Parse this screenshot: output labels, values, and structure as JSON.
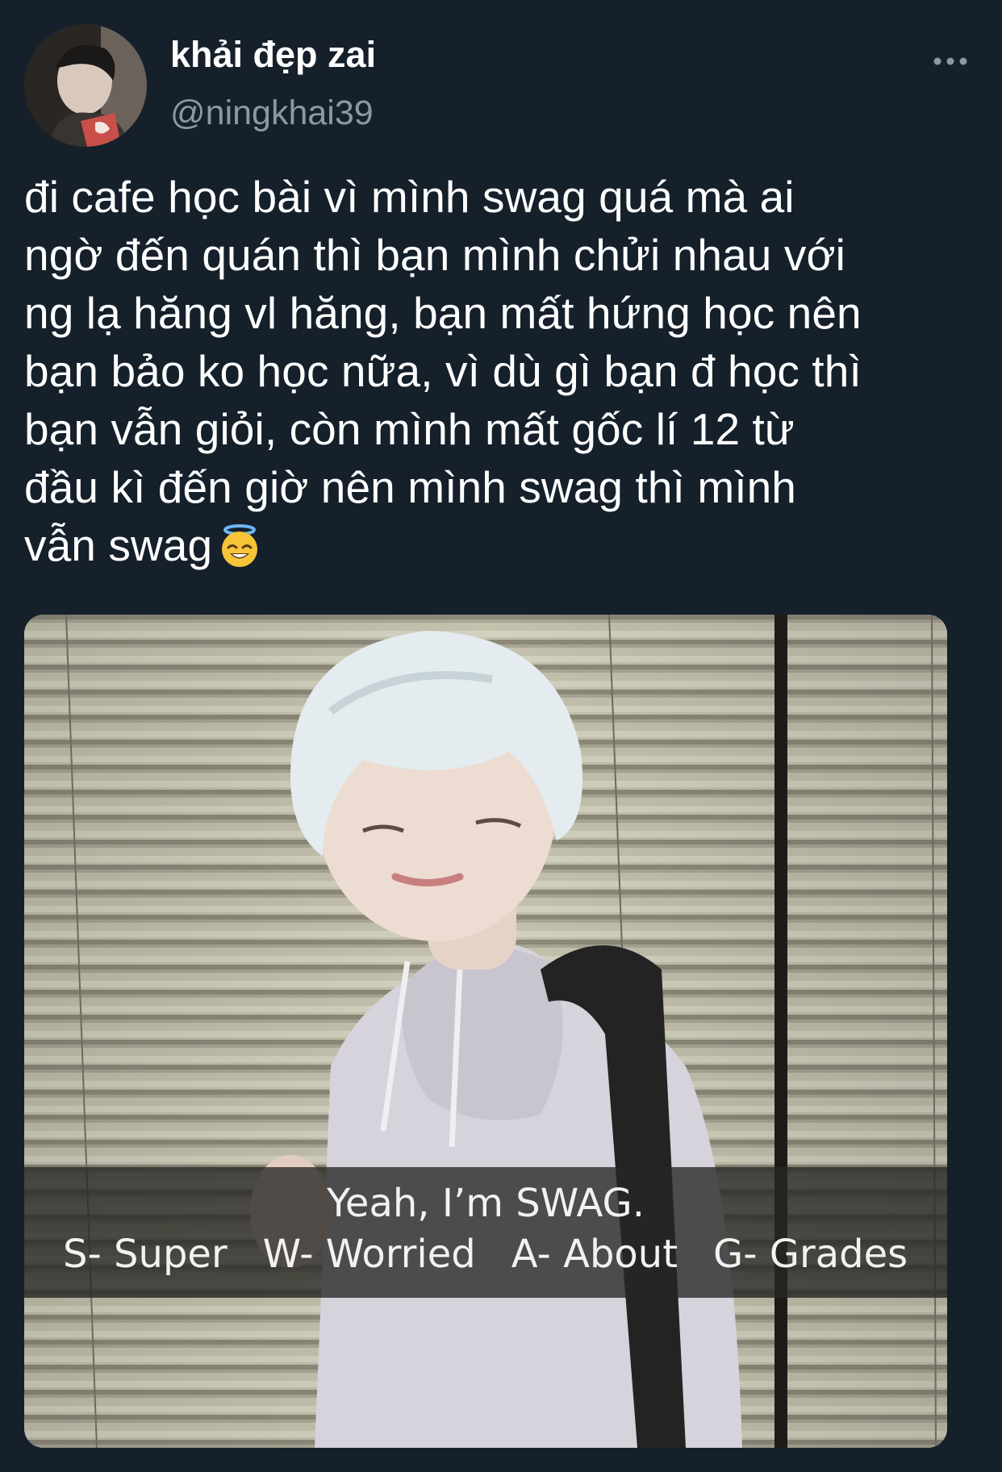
{
  "tweet": {
    "display_name": "khải đẹp zai",
    "handle": "@ningkhai39",
    "more_icon": "more-horizontal-icon",
    "text_lines": [
      "đi cafe học bài vì mình swag quá mà ai",
      "ngờ đến quán thì bạn mình chửi nhau với",
      "ng lạ hăng vl hăng, bạn mất hứng học nên",
      "bạn bảo ko học nữa, vì dù gì bạn đ học thì",
      "bạn vẫn giỏi, còn mình mất gốc lí 12 từ",
      "đầu kì đến giờ nên mình swag thì mình",
      "vẫn swag"
    ],
    "emoji": "smiling-face-with-halo-emoji"
  },
  "media": {
    "caption_line1": "Yeah, I’m SWAG.",
    "caption_words": [
      "S- Super",
      "W- Worried",
      "A- About",
      "G- Grades"
    ]
  },
  "colors": {
    "background": "#15202b",
    "secondary_text": "#8b98a5",
    "primary_text": "#ffffff"
  }
}
